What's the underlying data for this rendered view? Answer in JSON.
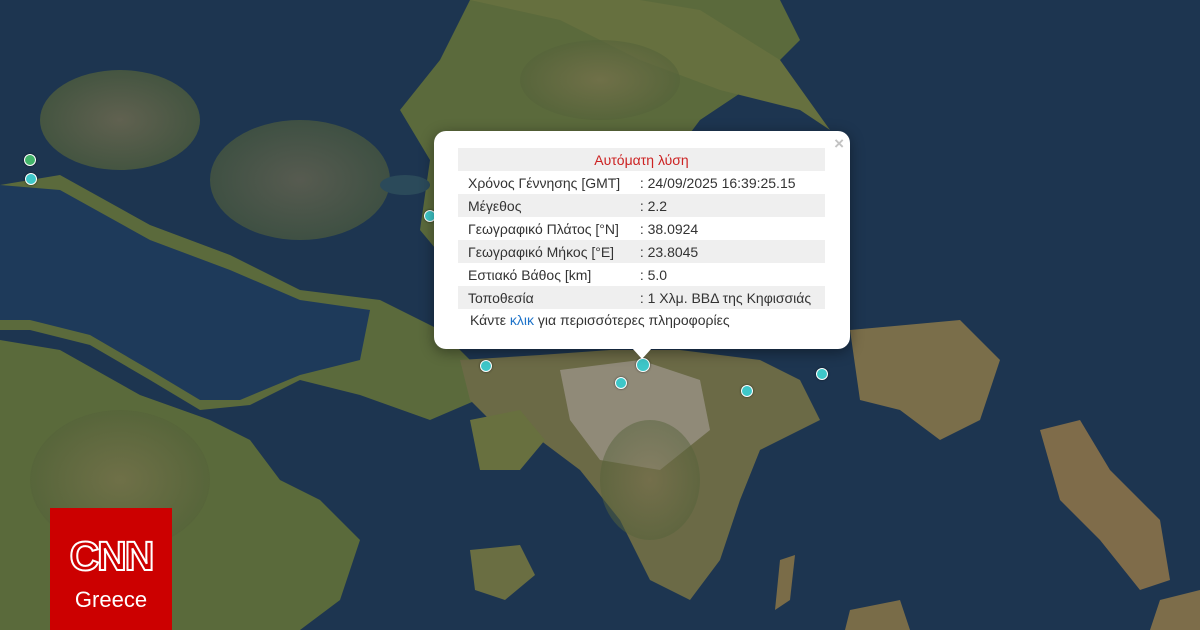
{
  "map": {
    "colors": {
      "sea": "#1d3550",
      "land": "#5f6a40",
      "land_light": "#8a7d55",
      "urban": "#9c958a",
      "marker": "#3ec7c9",
      "marker_old": "#42b46a"
    },
    "markers": [
      {
        "name": "marker-1",
        "color": "#42b46a"
      },
      {
        "name": "marker-2",
        "color": "#3ec7c9"
      },
      {
        "name": "marker-3",
        "color": "#3ec7c9"
      },
      {
        "name": "marker-4",
        "color": "#3ec7c9"
      },
      {
        "name": "marker-5",
        "color": "#3ec7c9"
      },
      {
        "name": "marker-6",
        "color": "#3ec7c9"
      },
      {
        "name": "marker-7",
        "color": "#3ec7c9"
      },
      {
        "name": "marker-8",
        "color": "#3ec7c9"
      }
    ]
  },
  "popup": {
    "close_symbol": "×",
    "title": "Αυτόματη λύση",
    "rows": [
      {
        "label": "Χρόνος Γέννησης [GMT]",
        "value": ": 24/09/2025 16:39:25.15"
      },
      {
        "label": "Μέγεθος",
        "value": ": 2.2"
      },
      {
        "label": "Γεωγραφικό Πλάτος [°N]",
        "value": ": 38.0924"
      },
      {
        "label": "Γεωγραφικό Μήκος [°E]",
        "value": ": 23.8045"
      },
      {
        "label": "Εστιακό Βάθος [km]",
        "value": ": 5.0"
      },
      {
        "label": "Τοποθεσία",
        "value": ": 1 Χλμ. ΒΒΔ της Κηφισσιάς"
      }
    ],
    "more_prefix": "Κάντε ",
    "more_link": "κλικ",
    "more_suffix": " για περισσότερες πληροφορίες"
  },
  "logo": {
    "brand": "CNN",
    "region": "Greece",
    "color": "#cc0000"
  }
}
